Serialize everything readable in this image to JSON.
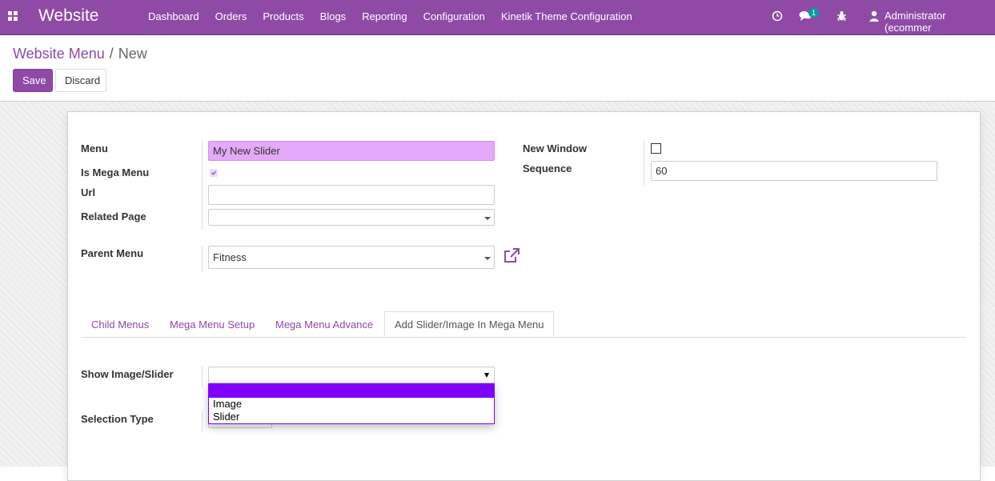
{
  "navbar": {
    "brand": "Website",
    "menu": [
      "Dashboard",
      "Orders",
      "Products",
      "Blogs",
      "Reporting",
      "Configuration",
      "Kinetik Theme Configuration"
    ],
    "messages_count": "1",
    "user": "Administrator (ecommer"
  },
  "breadcrumb": {
    "parent": "Website Menu",
    "separator": "/",
    "current": "New"
  },
  "buttons": {
    "save": "Save",
    "discard": "Discard"
  },
  "form": {
    "menu_label": "Menu",
    "menu_value": "My New Slider",
    "is_mega_menu_label": "Is Mega Menu",
    "is_mega_menu_checked": true,
    "url_label": "Url",
    "url_value": "",
    "related_page_label": "Related Page",
    "related_page_value": "",
    "new_window_label": "New Window",
    "new_window_checked": false,
    "sequence_label": "Sequence",
    "sequence_value": "60",
    "parent_menu_label": "Parent Menu",
    "parent_menu_value": "Fitness"
  },
  "tabs": [
    {
      "label": "Child Menus",
      "active": false
    },
    {
      "label": "Mega Menu Setup",
      "active": false
    },
    {
      "label": "Mega Menu Advance",
      "active": false
    },
    {
      "label": "Add Slider/Image In Mega Menu",
      "active": true
    }
  ],
  "tab_content": {
    "show_image_slider_label": "Show Image/Slider",
    "show_image_slider_value": "",
    "selection_type_label": "Selection Type",
    "dropdown_options": [
      "",
      "Image",
      "Slider"
    ]
  },
  "colors": {
    "primary": "#8f4aa6",
    "required_field": "#e4a9f9",
    "dropdown_highlight": "#7f00ff",
    "badge": "#00a09d"
  }
}
